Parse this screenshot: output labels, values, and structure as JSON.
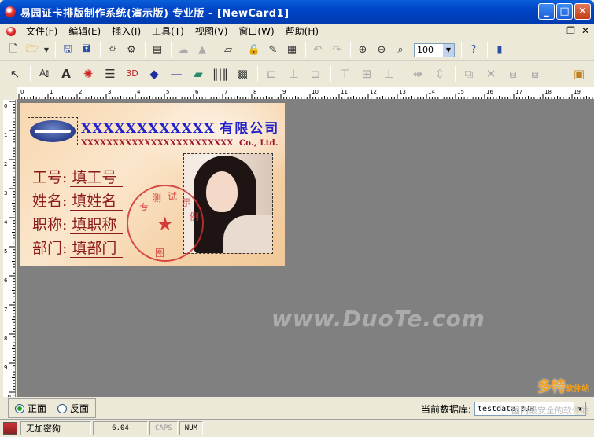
{
  "window": {
    "title": "易园证卡排版制作系统(演示版) 专业版 - [NewCard1]"
  },
  "menu": {
    "items": [
      "文件(F)",
      "编辑(E)",
      "插入(I)",
      "工具(T)",
      "视图(V)",
      "窗口(W)",
      "帮助(H)"
    ]
  },
  "toolbar": {
    "zoom_value": "100"
  },
  "card": {
    "company_x": "XXXXXXXXXXXX",
    "company_cn": "有限公司",
    "company_en_x": "XXXXXXXXXXXXXXXXXXXXXXXX",
    "company_en_suffix": "Co., Ltd.",
    "fields": [
      {
        "label": "工号:",
        "value": "填工号"
      },
      {
        "label": "姓名:",
        "value": "填姓名"
      },
      {
        "label": "职称:",
        "value": "填职称"
      },
      {
        "label": "部门:",
        "value": "填部门"
      }
    ],
    "stamp_chars": [
      "测",
      "试",
      "示",
      "例",
      "图",
      "专"
    ]
  },
  "canvas": {
    "watermark": "www.DuoTe.com"
  },
  "bottom": {
    "front_label": "正面",
    "back_label": "反面",
    "front_selected": true,
    "db_label": "当前数据库:",
    "db_value": "testdata.zDB"
  },
  "status": {
    "encryption": "无加密狗",
    "version": "6.04",
    "caps": "CAPS",
    "num": "NUM"
  },
  "branding": {
    "big": "多特",
    "small": "软件站",
    "tagline": "国内最安全的软件站"
  }
}
